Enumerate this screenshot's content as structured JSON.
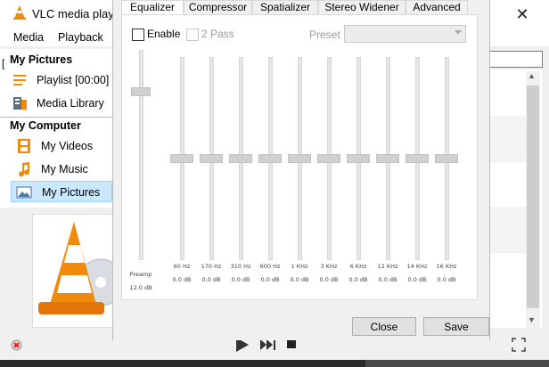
{
  "app": {
    "title": "VLC media playe",
    "menu": [
      "Media",
      "Playback"
    ],
    "close_glyph": "✕",
    "left_bracket": "["
  },
  "sidebar": {
    "sections": [
      {
        "heading": "My Pictures",
        "items": [
          {
            "label": "Playlist [00:00]",
            "icon": "playlist-icon"
          },
          {
            "label": "Media Library",
            "icon": "media-library-icon"
          }
        ]
      },
      {
        "heading": "My Computer",
        "items": [
          {
            "label": "My Videos",
            "icon": "film-icon"
          },
          {
            "label": "My Music",
            "icon": "music-note-icon"
          },
          {
            "label": "My Pictures",
            "icon": "picture-icon",
            "selected": true
          }
        ]
      }
    ]
  },
  "dialog": {
    "tabs": [
      "Equalizer",
      "Compressor",
      "Spatializer",
      "Stereo Widener",
      "Advanced"
    ],
    "active_tab": "Equalizer",
    "enable_label": "Enable",
    "enable_checked": false,
    "two_pass_label": "2 Pass",
    "two_pass_enabled": false,
    "preset_label": "Preset",
    "preset_value": "",
    "preamp": {
      "label": "Preamp",
      "value": "12.0 dB",
      "level": 0.8
    },
    "bands": [
      {
        "freq": "60 Hz",
        "value": "0.0 dB",
        "level": 0.5
      },
      {
        "freq": "170 Hz",
        "value": "0.0 dB",
        "level": 0.5
      },
      {
        "freq": "310 Hz",
        "value": "0.0 dB",
        "level": 0.5
      },
      {
        "freq": "600 Hz",
        "value": "0.0 dB",
        "level": 0.5
      },
      {
        "freq": "1 KHz",
        "value": "0.0 dB",
        "level": 0.5
      },
      {
        "freq": "3 KHz",
        "value": "0.0 dB",
        "level": 0.5
      },
      {
        "freq": "6 KHz",
        "value": "0.0 dB",
        "level": 0.5
      },
      {
        "freq": "12 KHz",
        "value": "0.0 dB",
        "level": 0.5
      },
      {
        "freq": "14 KHz",
        "value": "0.0 dB",
        "level": 0.5
      },
      {
        "freq": "16 KHz",
        "value": "0.0 dB",
        "level": 0.5
      }
    ],
    "close_label": "Close",
    "save_label": "Save"
  },
  "colors": {
    "accent_orange": "#f08a0c",
    "selection": "#cce8ff"
  }
}
